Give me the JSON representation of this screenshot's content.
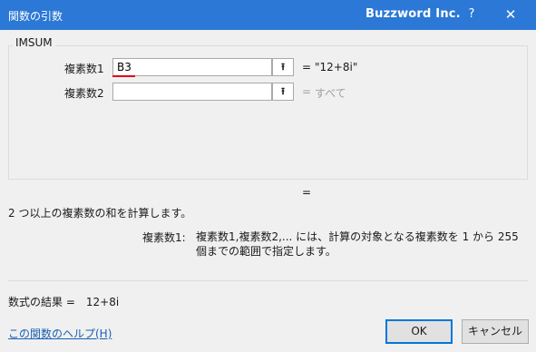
{
  "window": {
    "title": "関数の引数",
    "brand": "Buzzword Inc.",
    "help_glyph": "?",
    "close_glyph": "✕",
    "accent": "#2b78d6"
  },
  "function": {
    "name": "IMSUM",
    "arguments": [
      {
        "label": "複素数1",
        "value": "B3",
        "ref_icon": "collapse-dialog-icon",
        "equals": "=",
        "result": "\"12+8i\""
      },
      {
        "label": "複素数2",
        "value": "",
        "ref_icon": "collapse-dialog-icon",
        "equals": "=",
        "result": "すべて"
      }
    ],
    "overall_equals": "=",
    "description": "2 つ以上の複素数の和を計算します。",
    "arg_help_label": "複素数1:",
    "arg_help_text": "複素数1,複素数2,... には、計算の対象となる複素数を 1 から 255 個までの範囲で指定します。"
  },
  "result": {
    "label": "数式の結果 =",
    "value": "12+8i"
  },
  "footer": {
    "help_link": "この関数のヘルプ(H)",
    "ok_label": "OK",
    "cancel_label": "キャンセル"
  }
}
